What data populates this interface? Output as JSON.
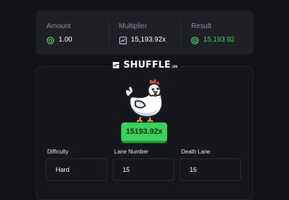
{
  "stats": {
    "amount": {
      "label": "Amount",
      "value": "1.00",
      "icon": "coin-icon"
    },
    "multiplier": {
      "label": "Multiplier",
      "value": "15,193.92x",
      "icon": "chart-icon"
    },
    "result": {
      "label": "Result",
      "value": "15,193.92",
      "icon": "coin-icon"
    }
  },
  "brand": {
    "name": "SHUFFLE",
    "tld": ".us"
  },
  "game": {
    "mascot": "chicken",
    "multiplier_badge": "15193.92x"
  },
  "fields": {
    "difficulty": {
      "label": "Difficulty",
      "value": "Hard"
    },
    "lane_number": {
      "label": "Lane Number",
      "value": "15"
    },
    "death_lane": {
      "label": "Death Lane",
      "value": "16"
    }
  },
  "colors": {
    "accent_green": "#3ccf5b",
    "background": "#131418",
    "card": "#1e2026"
  }
}
